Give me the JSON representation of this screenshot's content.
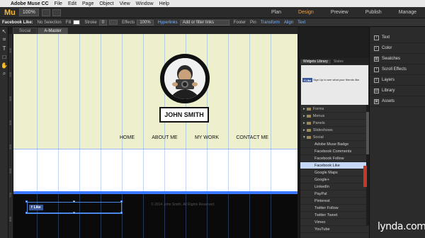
{
  "menubar": {
    "apple": "",
    "app_name": "Adobe Muse CC",
    "items": [
      "File",
      "Edit",
      "Page",
      "Object",
      "View",
      "Window",
      "Help"
    ]
  },
  "appbar": {
    "logo": "Mu",
    "zoom": "100%",
    "modes": [
      "Plan",
      "Design",
      "Preview",
      "Publish",
      "Manage"
    ],
    "active_mode": "Design"
  },
  "ctrlbar": {
    "element": "Facebook Like:",
    "selection": "No Selection",
    "fill_label": "Fill",
    "stroke_label": "Stroke",
    "stroke_value": "0",
    "effects_label": "Effects",
    "opacity": "100%",
    "hyperlinks": "Hyperlinks",
    "link_placeholder": "Add or filter links",
    "footer_label": "Footer",
    "pin_label": "Pin",
    "transform": "Transform",
    "align": "Align",
    "text": "Text"
  },
  "tabs": [
    "Social",
    "A-Master"
  ],
  "active_tab": "A-Master",
  "ruler_labels": [
    "100",
    "200",
    "300",
    "400",
    "500",
    "600",
    "700",
    "800"
  ],
  "page": {
    "name": "JOHN SMITH",
    "nav": [
      "HOME",
      "ABOUT ME",
      "MY WORK",
      "CONTACT ME"
    ],
    "copyright": "© 2014 John Smith. All Rights Reserved.",
    "fb_button": "Like"
  },
  "widgets_panel": {
    "tabs": [
      "Widgets Library",
      "States"
    ],
    "preview_button": "Like",
    "preview_text": "Sign Up to see what your friends like.",
    "categories": [
      "Forms",
      "Menus",
      "Panels",
      "Slideshows",
      "Social"
    ],
    "social_items": [
      "Adobe Muse Badge",
      "Facebook Comments",
      "Facebook Follow",
      "Facebook Like",
      "Google Maps",
      "Google+",
      "LinkedIn",
      "PayPal",
      "Pinterest",
      "Twitter Follow",
      "Twitter Tweet",
      "Vimeo",
      "YouTube"
    ],
    "selected": "Facebook Like"
  },
  "right_panel": [
    "Text",
    "Color",
    "Swatches",
    "Scroll Effects",
    "Layers",
    "Library",
    "Assets"
  ],
  "watermark": "lynda.com",
  "colors": {
    "accent": "#f7a23a",
    "facebook": "#3b5998",
    "page_bg": "#eef0cd",
    "selection": "#c6d8f5"
  }
}
